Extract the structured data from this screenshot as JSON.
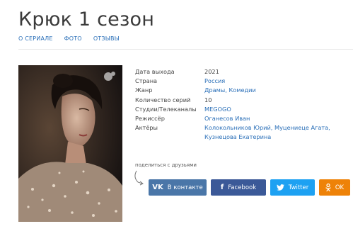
{
  "page": {
    "title": "Крюк 1 сезон"
  },
  "nav": {
    "items": [
      "О СЕРИАЛЕ",
      "ФОТО",
      "ОТЗЫВЫ"
    ]
  },
  "info": {
    "rows": [
      {
        "label": "Дата выхода",
        "value": "2021"
      },
      {
        "label": "Страна",
        "value": "Россия"
      },
      {
        "label": "Жанр",
        "value": "Драмы, Комедии"
      },
      {
        "label": "Количество серий",
        "value": "10"
      },
      {
        "label": "Студии/Телеканалы",
        "value": "MEGOGO"
      },
      {
        "label": "Режиссёр",
        "value": "Оганесов Иван"
      },
      {
        "label": "Актёры",
        "value": "Колокольников Юрий, Муцениеце Агата, Кузнецова Екатерина"
      }
    ]
  },
  "share": {
    "label": "поделиться с друзьями",
    "buttons": [
      {
        "icon": "vk-icon",
        "glyph": "VK",
        "label": "В контакте",
        "color": "#4a76a8"
      },
      {
        "icon": "facebook-icon",
        "glyph": "f",
        "label": "Facebook",
        "color": "#3b5998"
      },
      {
        "icon": "twitter-icon",
        "glyph": "🐦",
        "label": "Twitter",
        "color": "#1da1f2"
      },
      {
        "icon": "odnoklassniki-icon",
        "glyph": "OK",
        "label": "OK",
        "color": "#ee8208"
      }
    ]
  },
  "colors": {
    "link": "#2a6fb8",
    "text": "#444444"
  }
}
